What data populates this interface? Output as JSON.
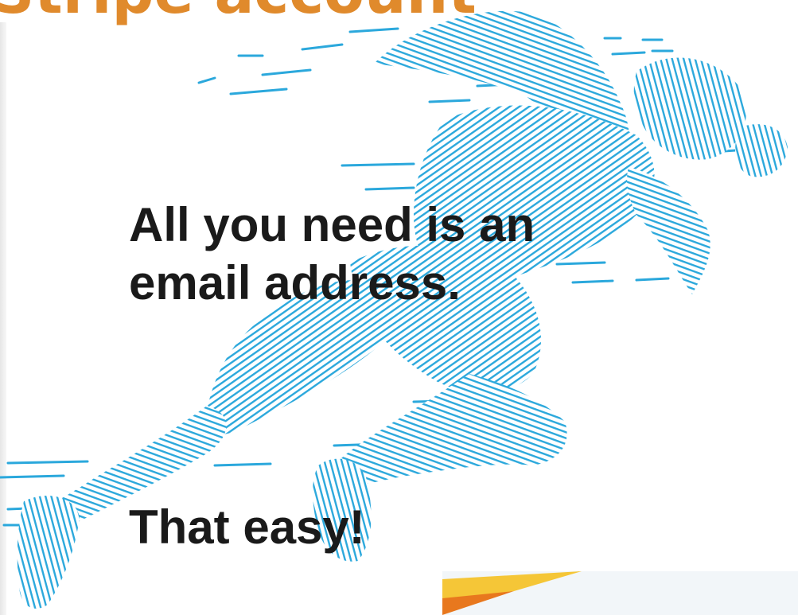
{
  "header": {
    "title": "Stripe account"
  },
  "content": {
    "headline": "All you need is an email address.",
    "tagline": "That easy!"
  },
  "illustration": {
    "subject": "sprinter",
    "line_color": "#2ba8dc"
  },
  "colors": {
    "title": "#e08a2c",
    "body_text": "#1a1a1a",
    "accent_yellow": "#f5c637",
    "accent_orange": "#e8781e",
    "background": "#ffffff"
  }
}
